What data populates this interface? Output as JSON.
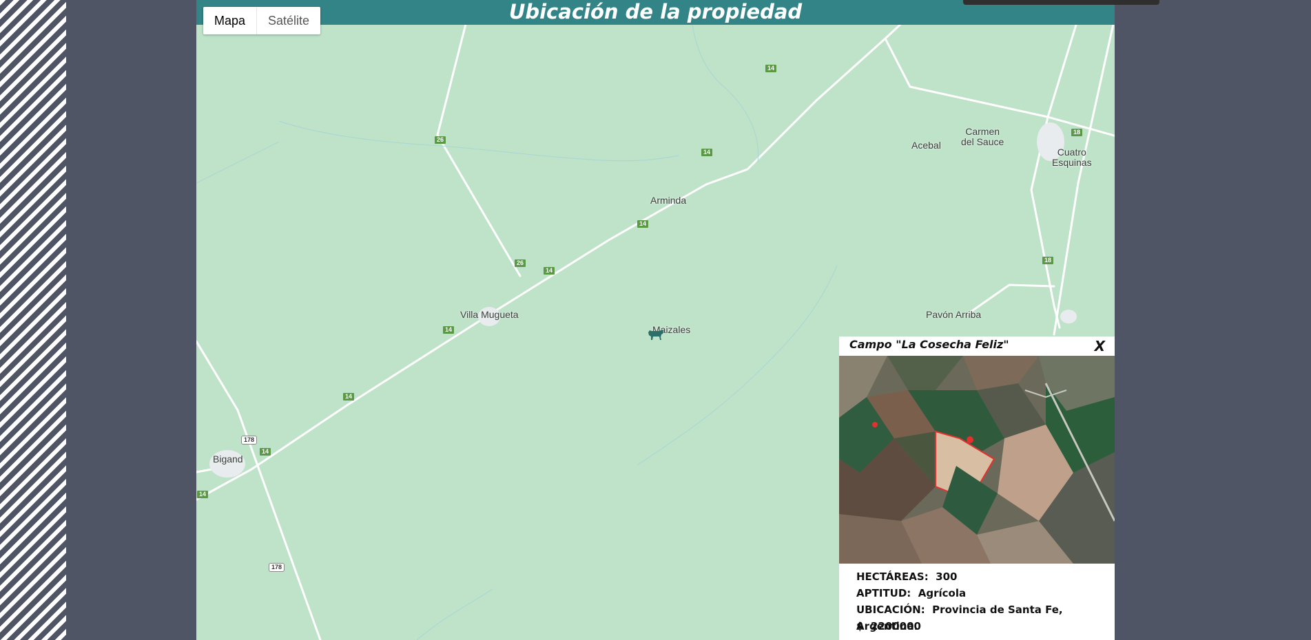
{
  "header": {
    "title": "Ubicación de la propiedad"
  },
  "map_type": {
    "map_label": "Mapa",
    "satellite_label": "Satélite",
    "selected": "Mapa"
  },
  "places": {
    "arminda": "Arminda",
    "villa_mugueta": "Villa Mugueta",
    "maizales": "Maizales",
    "bigand": "Bigand",
    "acebal": "Acebal",
    "carmen_line1": "Carmen",
    "carmen_line2": "del Sauce",
    "cuatro_line1": "Cuatro",
    "cuatro_line2": "Esquinas",
    "pavon_arriba": "Pavón Arriba"
  },
  "route_shields": {
    "r14": "14",
    "r26": "26",
    "r18": "18",
    "r178": "178"
  },
  "info_window": {
    "title": "Campo \"La Cosecha Feliz\"",
    "close": "X",
    "hectares_label": "HECTÁREAS:",
    "hectares_value": "300",
    "aptitude_label": "APTITUD:",
    "aptitude_value": "Agrícola",
    "location_label": "UBICACIÓN:",
    "location_value": "Provincia de Santa Fe, Argentina.",
    "price_label": "$",
    "price_value": "2200000"
  },
  "colors": {
    "title_bar": "#328487",
    "page_bg": "#4f5564",
    "map_bg": "#bfe3c9",
    "road": "#ffffff",
    "marker": "#2b6f6b"
  },
  "icons": {
    "marker": "cow-marker-icon",
    "close": "close-icon"
  }
}
